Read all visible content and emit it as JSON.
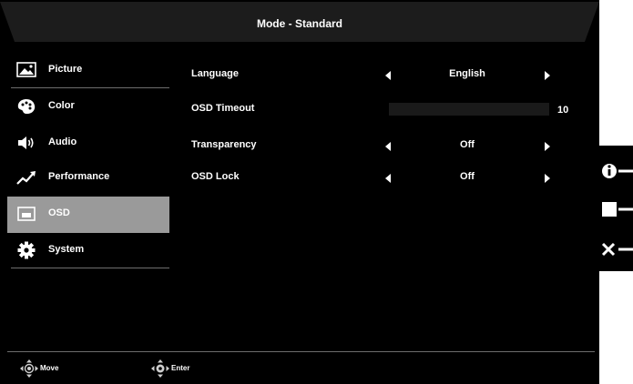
{
  "header": {
    "title": "Mode - Standard"
  },
  "sidebar": {
    "items": [
      {
        "label": "Picture",
        "icon": "picture-icon",
        "selected": false
      },
      {
        "label": "Color",
        "icon": "palette-icon",
        "selected": false
      },
      {
        "label": "Audio",
        "icon": "speaker-icon",
        "selected": false
      },
      {
        "label": "Performance",
        "icon": "trend-arrow-icon",
        "selected": false
      },
      {
        "label": "OSD",
        "icon": "osd-window-icon",
        "selected": true
      },
      {
        "label": "System",
        "icon": "gear-icon",
        "selected": false
      }
    ]
  },
  "settings": {
    "language": {
      "label": "Language",
      "value": "English"
    },
    "osd_timeout": {
      "label": "OSD Timeout",
      "value": "10"
    },
    "transparency": {
      "label": "Transparency",
      "value": "Off"
    },
    "osd_lock": {
      "label": "OSD Lock",
      "value": "Off"
    }
  },
  "footer": {
    "move_label": "Move",
    "enter_label": "Enter"
  },
  "hardware_keys": [
    "info-key-icon",
    "square-key-icon",
    "close-key-icon"
  ],
  "colors": {
    "background": "#000000",
    "selected_item": "#9a9a9a",
    "separator": "#6e6e6e",
    "text": "#ffffff"
  }
}
